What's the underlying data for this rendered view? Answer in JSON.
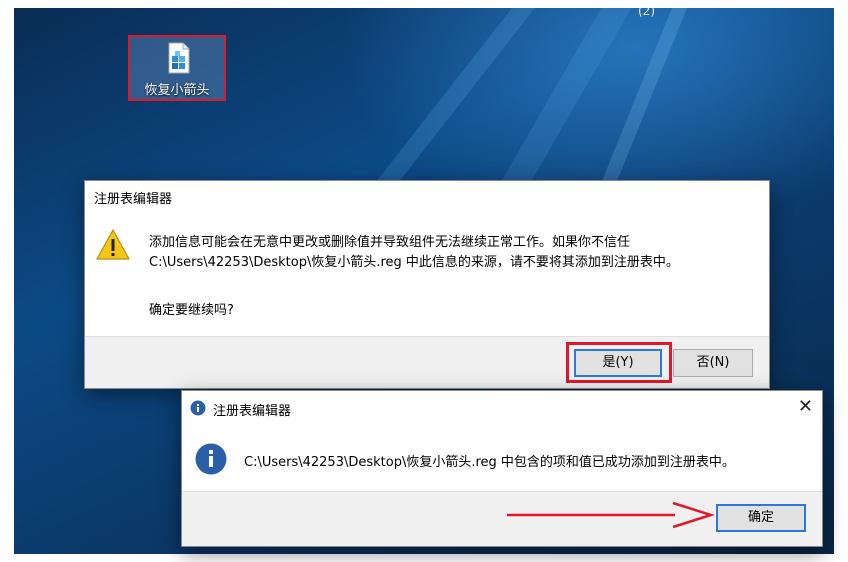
{
  "desktop": {
    "top_text": "(2)",
    "icon": {
      "name": "reg-file-icon",
      "label": "恢复小箭头"
    }
  },
  "warning_dialog": {
    "title": "注册表编辑器",
    "message_line1": "添加信息可能会在无意中更改或删除值并导致组件无法继续正常工作。如果你不信任",
    "message_line2": "C:\\Users\\42253\\Desktop\\恢复小箭头.reg 中此信息的来源，请不要将其添加到注册表中。",
    "question": "确定要继续吗?",
    "yes_label": "是(Y)",
    "no_label": "否(N)"
  },
  "info_dialog": {
    "title": "注册表编辑器",
    "close_glyph": "✕",
    "message": "C:\\Users\\42253\\Desktop\\恢复小箭头.reg 中包含的项和值已成功添加到注册表中。",
    "ok_label": "确定"
  },
  "colors": {
    "highlight_red": "#e0182b",
    "info_blue": "#2b5fa8",
    "warning_yellow": "#f5c518"
  }
}
